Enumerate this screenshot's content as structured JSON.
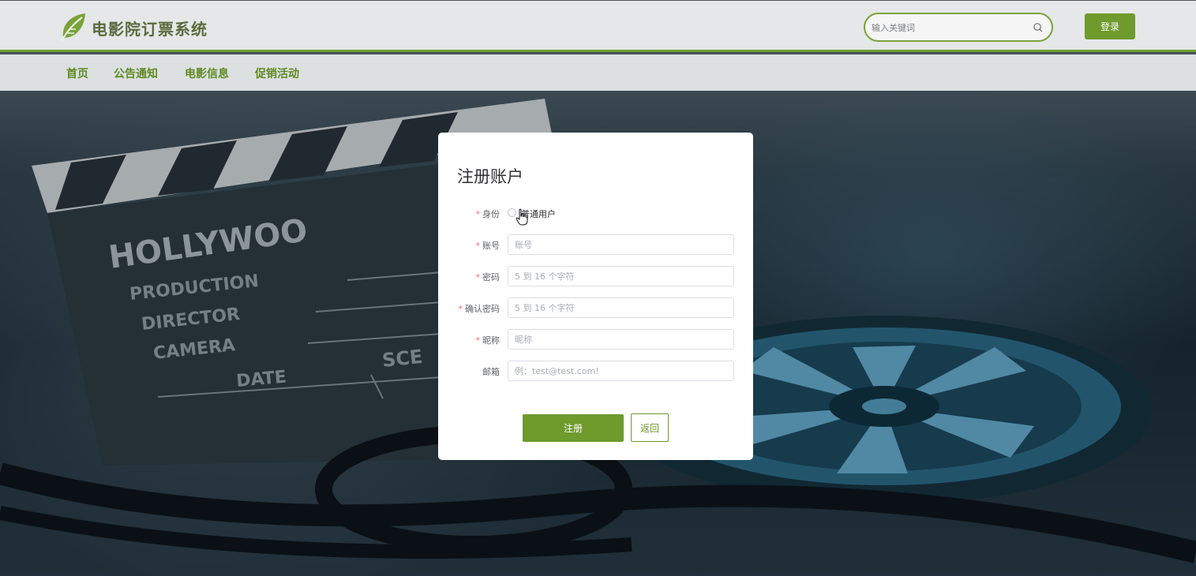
{
  "header": {
    "site_title": "电影院订票系统",
    "search_placeholder": "输入关键词",
    "login_label": "登录"
  },
  "nav": {
    "items": [
      {
        "label": "首页"
      },
      {
        "label": "公告通知"
      },
      {
        "label": "电影信息"
      },
      {
        "label": "促销活动"
      }
    ]
  },
  "background": {
    "clapboard_lines": [
      "HOLLYWOO",
      "PRODUCTION",
      "DIRECTOR",
      "CAMERA",
      "DATE",
      "SCE"
    ]
  },
  "form": {
    "title": "注册账户",
    "identity": {
      "label": "身份",
      "option": "普通用户",
      "selected": false
    },
    "fields": [
      {
        "label": "账号",
        "required": true,
        "placeholder": "账号",
        "value": ""
      },
      {
        "label": "密码",
        "required": true,
        "placeholder": "5 到 16 个字符",
        "value": ""
      },
      {
        "label": "确认密码",
        "required": true,
        "placeholder": "5 到 16 个字符",
        "value": ""
      },
      {
        "label": "昵称",
        "required": true,
        "placeholder": "昵称",
        "value": ""
      },
      {
        "label": "邮箱",
        "required": false,
        "placeholder": "例：test@test.com!",
        "value": ""
      }
    ],
    "required_mark": "*",
    "register_label": "注册",
    "back_label": "返回"
  },
  "colors": {
    "accent": "#6f9a2c",
    "required": "#f56c6c"
  }
}
